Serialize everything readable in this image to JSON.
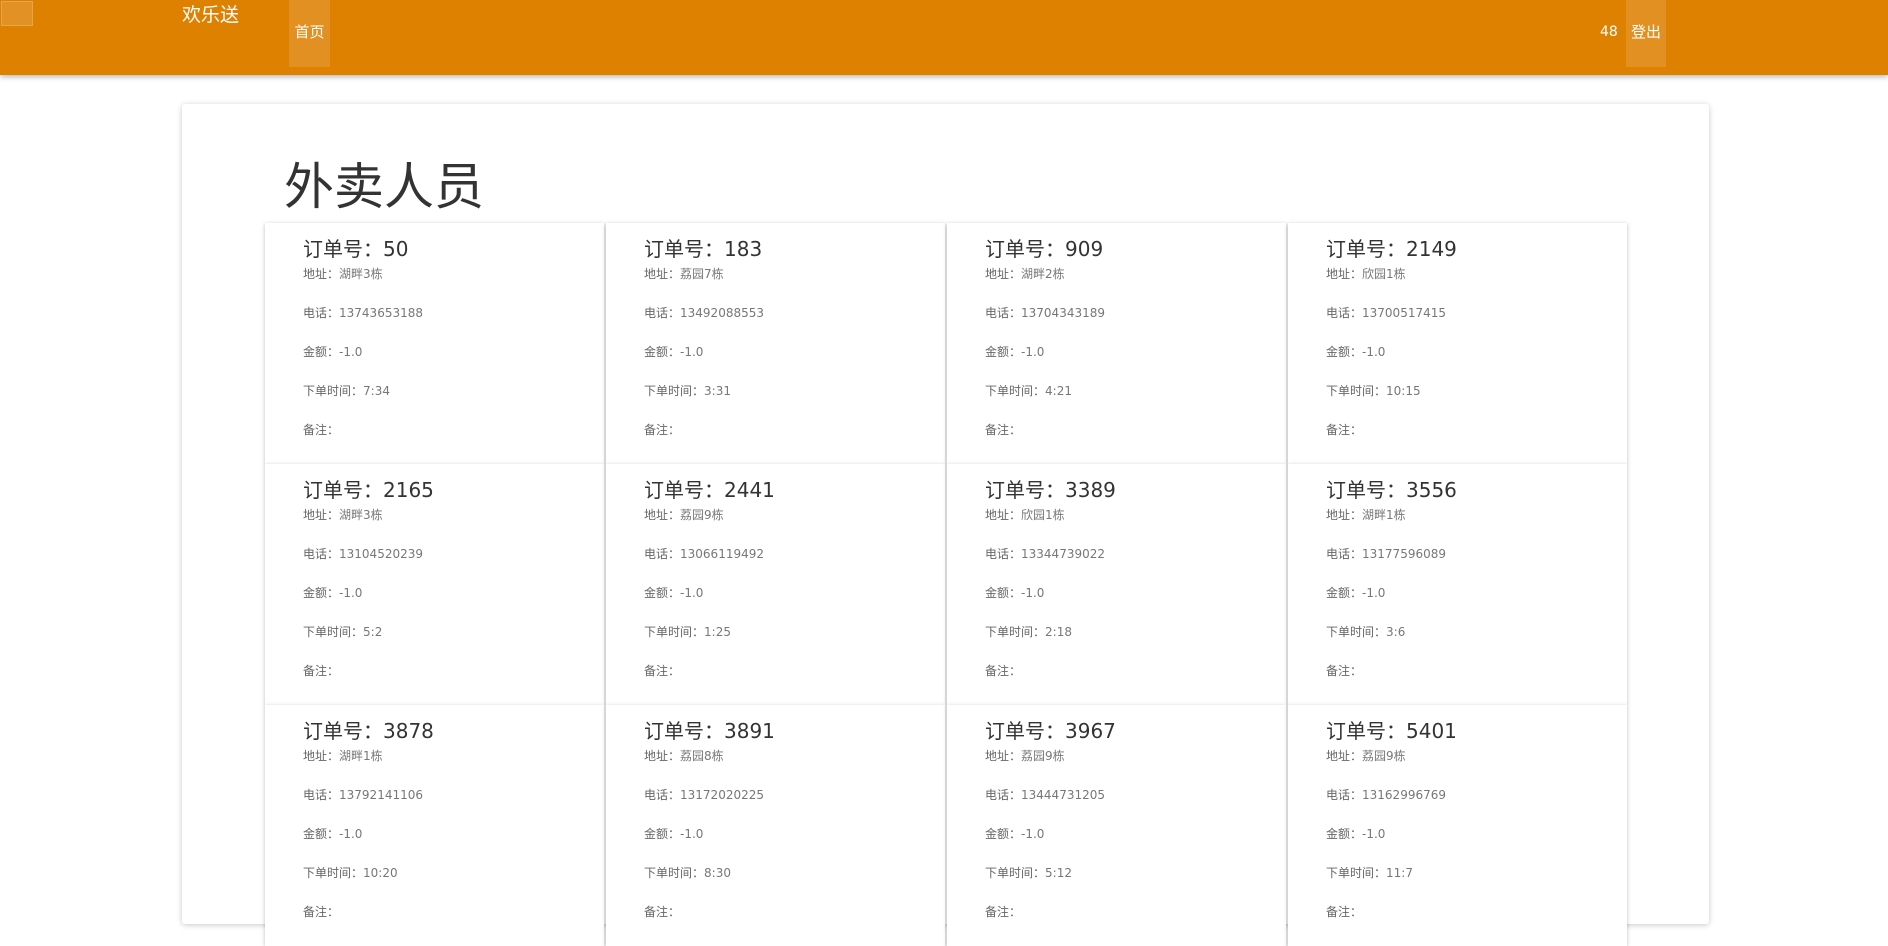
{
  "navbar": {
    "brand": "欢乐送",
    "home_label": "首页",
    "user_id": "48",
    "logout_label": "登出"
  },
  "page": {
    "title": "外卖人员"
  },
  "field_labels": {
    "address": "地址：",
    "phone": "电话：",
    "amount": "金额：",
    "order_time": "下单时间：",
    "note": "备注："
  },
  "orders": [
    {
      "title": "订单号：50",
      "address": "湖畔3栋",
      "phone": "13743653188",
      "amount": "-1.0",
      "time": "7:34",
      "note": ""
    },
    {
      "title": "订单号：183",
      "address": "荔园7栋",
      "phone": "13492088553",
      "amount": "-1.0",
      "time": "3:31",
      "note": ""
    },
    {
      "title": "订单号：909",
      "address": "湖畔2栋",
      "phone": "13704343189",
      "amount": "-1.0",
      "time": "4:21",
      "note": ""
    },
    {
      "title": "订单号：2149",
      "address": "欣园1栋",
      "phone": "13700517415",
      "amount": "-1.0",
      "time": "10:15",
      "note": ""
    },
    {
      "title": "订单号：2165",
      "address": "湖畔3栋",
      "phone": "13104520239",
      "amount": "-1.0",
      "time": "5:2",
      "note": ""
    },
    {
      "title": "订单号：2441",
      "address": "荔园9栋",
      "phone": "13066119492",
      "amount": "-1.0",
      "time": "1:25",
      "note": ""
    },
    {
      "title": "订单号：3389",
      "address": "欣园1栋",
      "phone": "13344739022",
      "amount": "-1.0",
      "time": "2:18",
      "note": ""
    },
    {
      "title": "订单号：3556",
      "address": "湖畔1栋",
      "phone": "13177596089",
      "amount": "-1.0",
      "time": "3:6",
      "note": ""
    },
    {
      "title": "订单号：3878",
      "address": "湖畔1栋",
      "phone": "13792141106",
      "amount": "-1.0",
      "time": "10:20",
      "note": ""
    },
    {
      "title": "订单号：3891",
      "address": "荔园8栋",
      "phone": "13172020225",
      "amount": "-1.0",
      "time": "8:30",
      "note": ""
    },
    {
      "title": "订单号：3967",
      "address": "荔园9栋",
      "phone": "13444731205",
      "amount": "-1.0",
      "time": "5:12",
      "note": ""
    },
    {
      "title": "订单号：5401",
      "address": "荔园9栋",
      "phone": "13162996769",
      "amount": "-1.0",
      "time": "11:7",
      "note": ""
    }
  ]
}
